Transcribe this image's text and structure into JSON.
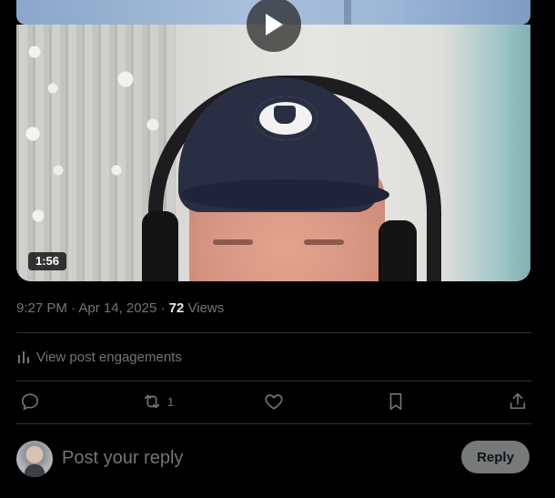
{
  "media": {
    "duration": "1:56"
  },
  "post_meta": {
    "time": "9:27 PM",
    "separator": "·",
    "date": "Apr 14, 2025",
    "views_count": "72",
    "views_label": "Views"
  },
  "engagements": {
    "label": "View post engagements",
    "icon": "bar-chart-icon"
  },
  "actions": {
    "reply_icon": "reply-icon",
    "repost_icon": "repost-icon",
    "repost_count": "1",
    "like_icon": "heart-icon",
    "bookmark_icon": "bookmark-icon",
    "share_icon": "share-icon"
  },
  "composer": {
    "placeholder": "Post your reply",
    "reply_button": "Reply"
  },
  "colors": {
    "background": "#000000",
    "text_secondary": "#71767b",
    "text_primary": "#e7e9ea",
    "divider": "#2f3336",
    "reply_button_bg": "#787a7a"
  }
}
